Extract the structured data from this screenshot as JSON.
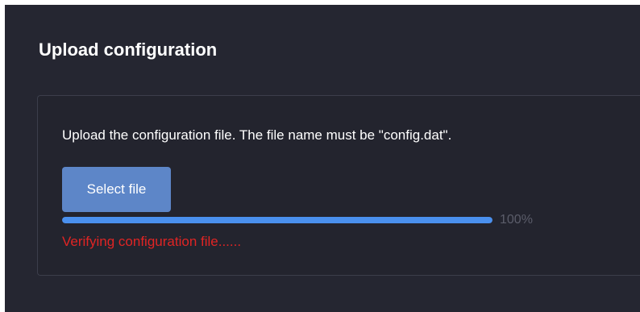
{
  "page": {
    "title": "Upload configuration"
  },
  "upload": {
    "description": "Upload the configuration file. The file name must be \"config.dat\".",
    "select_button_label": "Select file",
    "progress_percent": 100,
    "progress_label": "100%",
    "status_text": "Verifying configuration file......"
  },
  "colors": {
    "background": "#252631",
    "accent": "#4a90ee",
    "button": "#5d86c8",
    "error": "#e02424"
  }
}
